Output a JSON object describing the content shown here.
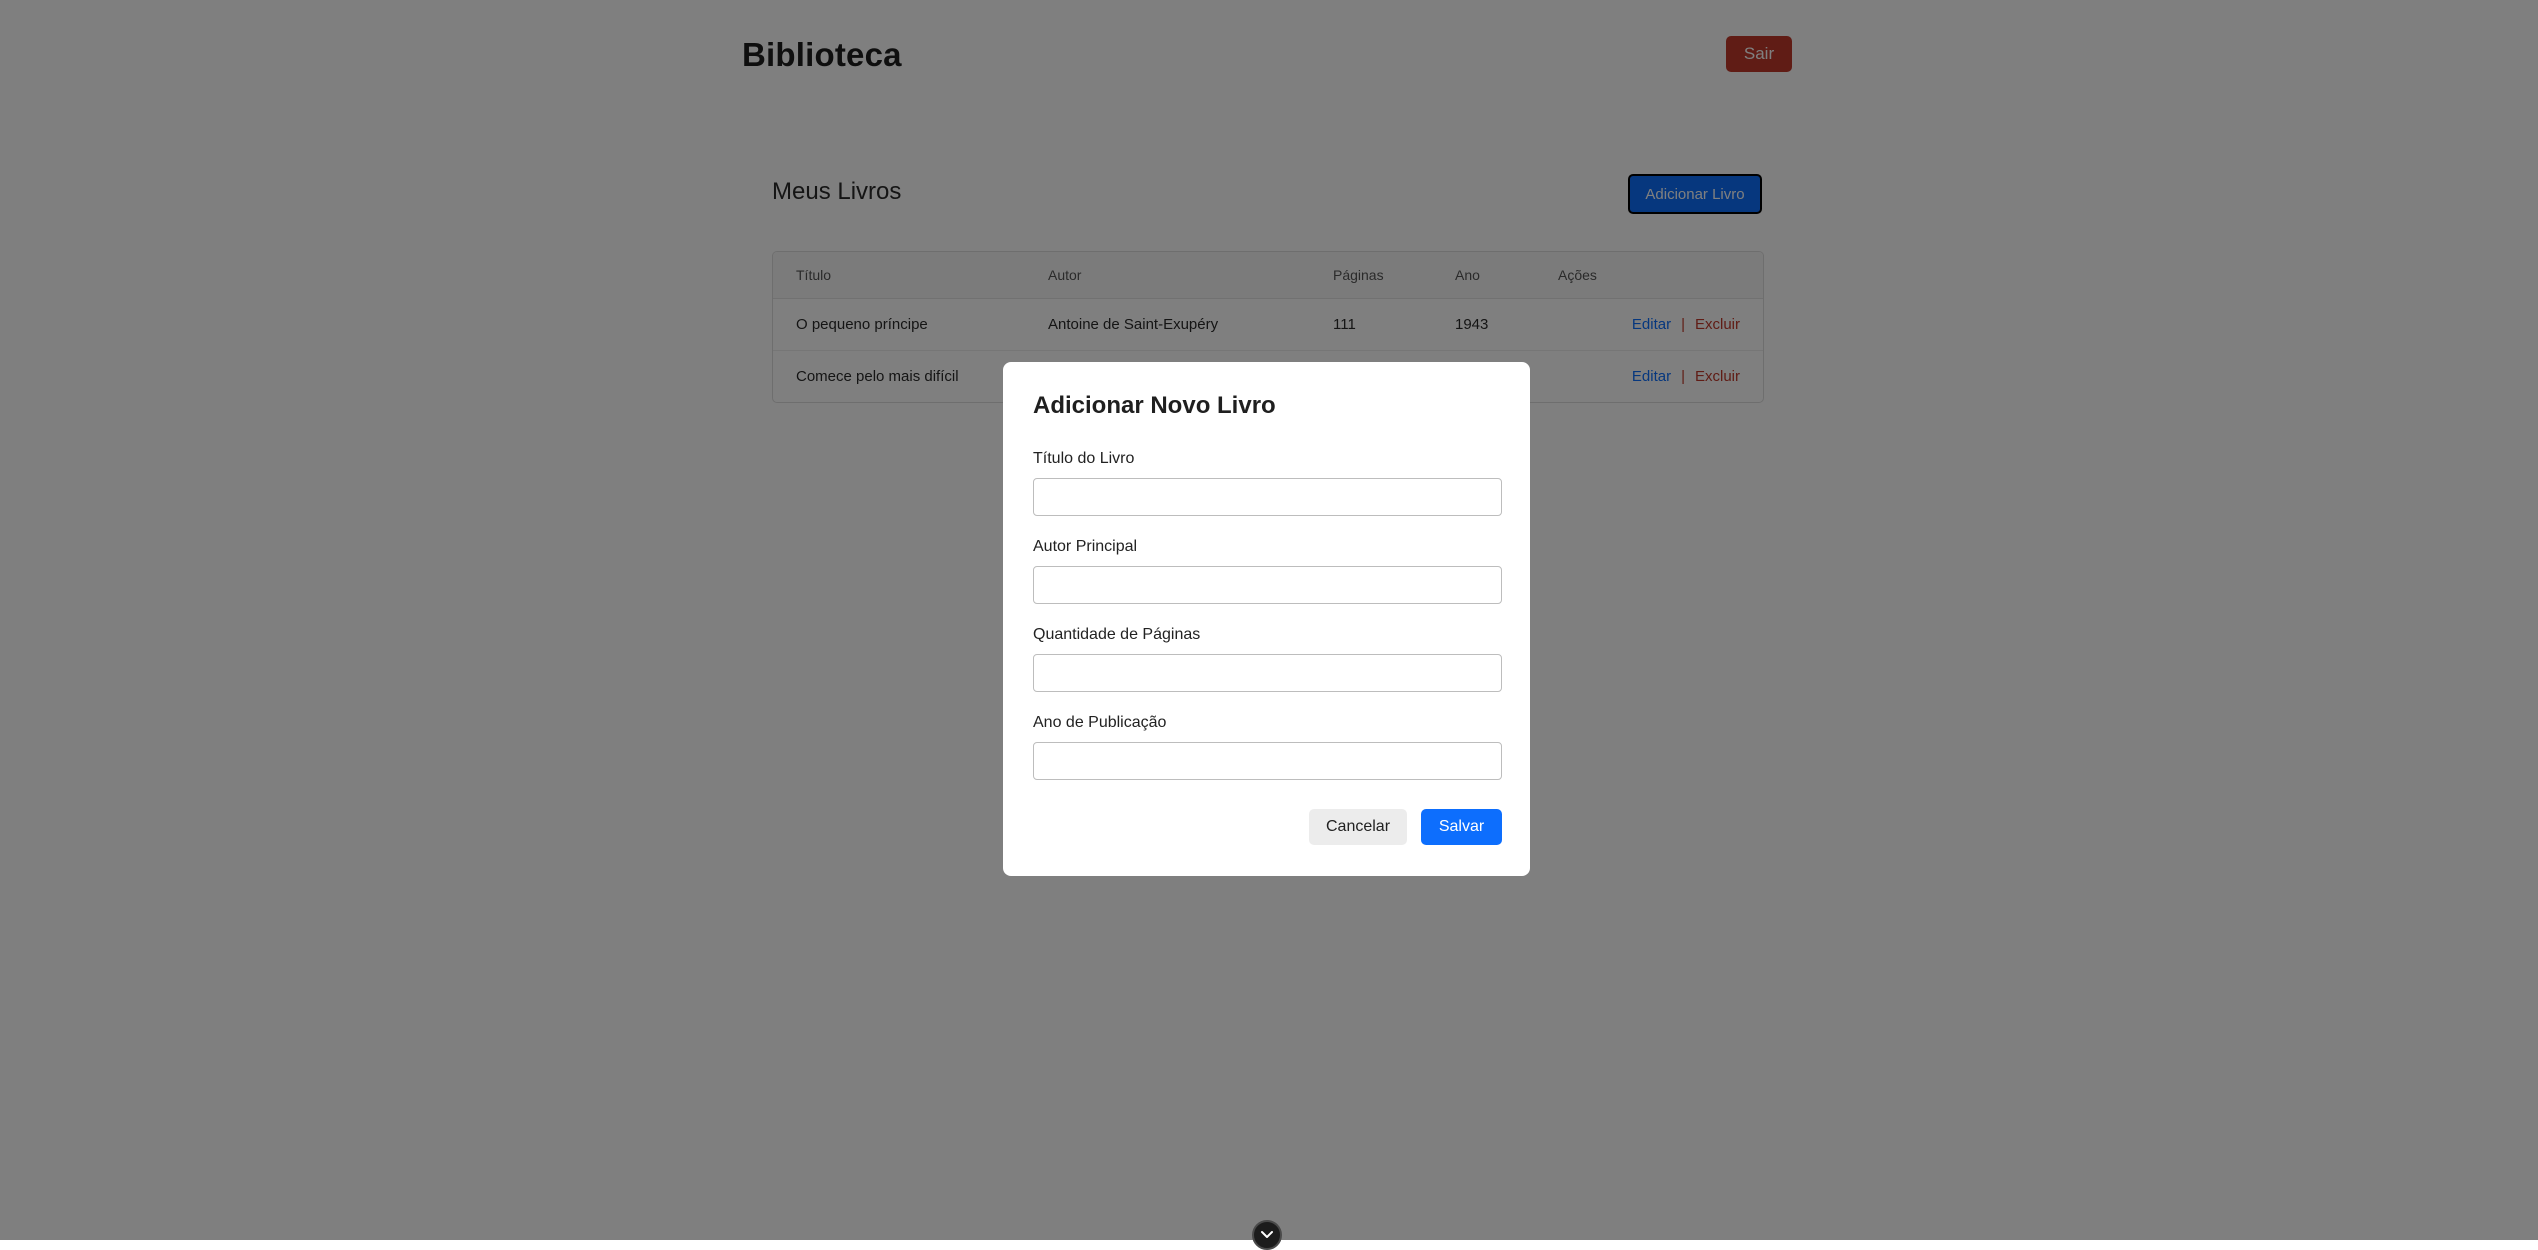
{
  "header": {
    "brand": "Biblioteca",
    "logout_label": "Sair"
  },
  "books": {
    "title": "Meus Livros",
    "add_label": "Adicionar Livro",
    "columns": [
      "Título",
      "Autor",
      "Páginas",
      "Ano",
      "Ações"
    ],
    "rows": [
      {
        "title": "O pequeno príncipe",
        "author": "Antoine de Saint-Exupéry",
        "pages": "111",
        "year": "1943",
        "edit": "Editar",
        "delete": "Excluir"
      },
      {
        "title": "Comece pelo mais difícil",
        "author": "",
        "pages": "",
        "year": "",
        "edit": "Editar",
        "delete": "Excluir"
      }
    ],
    "separator": "|"
  },
  "modal": {
    "title": "Adicionar Novo Livro",
    "fields": [
      {
        "label": "Título do Livro",
        "value": ""
      },
      {
        "label": "Autor Principal",
        "value": ""
      },
      {
        "label": "Quantidade de Páginas",
        "value": ""
      },
      {
        "label": "Ano de Publicação",
        "value": ""
      }
    ],
    "cancel_label": "Cancelar",
    "save_label": "Salvar"
  },
  "colors": {
    "primary": "#0d6efd",
    "danger": "#c0392b",
    "overlay": "rgba(0,0,0,0.5)"
  },
  "icons": {
    "floating_badge": "chevron-down-icon"
  }
}
